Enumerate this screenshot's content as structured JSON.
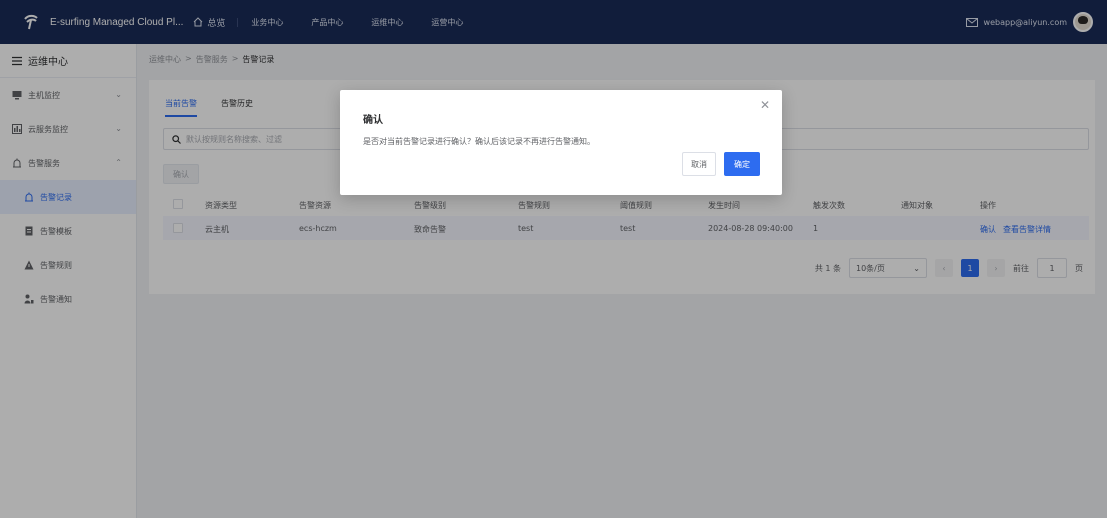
{
  "colors": {
    "topbar": "#1a2b57",
    "primary": "#2d6cf0",
    "sidebar_active": "#e8efff",
    "background": "#f0f2f5"
  },
  "topbar": {
    "brand": "E-surfing Managed Cloud Pl...",
    "home_label": "总览",
    "nav": [
      "业务中心",
      "产品中心",
      "运维中心",
      "运营中心"
    ],
    "email": "webapp@aliyun.com"
  },
  "sidebar": {
    "title": "运维中心",
    "items": [
      {
        "label": "主机监控",
        "icon": "host-monitor-icon",
        "chevron": "⌄"
      },
      {
        "label": "云服务监控",
        "icon": "cloud-monitor-icon",
        "chevron": "⌄"
      },
      {
        "label": "告警服务",
        "icon": "alarm-service-icon",
        "chevron": "⌃"
      }
    ],
    "subitems": [
      {
        "label": "告警记录",
        "icon": "alarm-record-icon",
        "active": true
      },
      {
        "label": "告警模板",
        "icon": "alarm-template-icon",
        "active": false
      },
      {
        "label": "告警规则",
        "icon": "alarm-rule-icon",
        "active": false
      },
      {
        "label": "告警通知",
        "icon": "alarm-notify-icon",
        "active": false
      }
    ]
  },
  "breadcrumb": {
    "items": [
      "运维中心",
      "告警服务",
      "告警记录"
    ],
    "separator": ">"
  },
  "tabs": [
    "当前告警",
    "告警历史"
  ],
  "search": {
    "placeholder": "默认按规则名称搜索、过滤"
  },
  "toolbar": {
    "confirm_label": "确认"
  },
  "table": {
    "headers": [
      "资源类型",
      "告警资源",
      "告警级别",
      "告警规则",
      "阈值规则",
      "发生时间",
      "触发次数",
      "通知对象",
      "操作"
    ],
    "rows": [
      {
        "resource_type": "云主机",
        "resource": "ecs-hczm",
        "level": "致命告警",
        "rule": "test",
        "threshold": "test",
        "time": "2024-08-28 09:40:00",
        "count": "1",
        "notify": "",
        "action_confirm": "确认",
        "action_detail": "查看告警详情"
      }
    ]
  },
  "pager": {
    "total": "共 1 条",
    "page_size": "10条/页",
    "current": "1",
    "goto_label": "前往",
    "goto_value": "1",
    "page_suffix": "页"
  },
  "modal": {
    "title": "确认",
    "body": "是否对当前告警记录进行确认？确认后该记录不再进行告警通知。",
    "cancel": "取消",
    "ok": "确定"
  }
}
